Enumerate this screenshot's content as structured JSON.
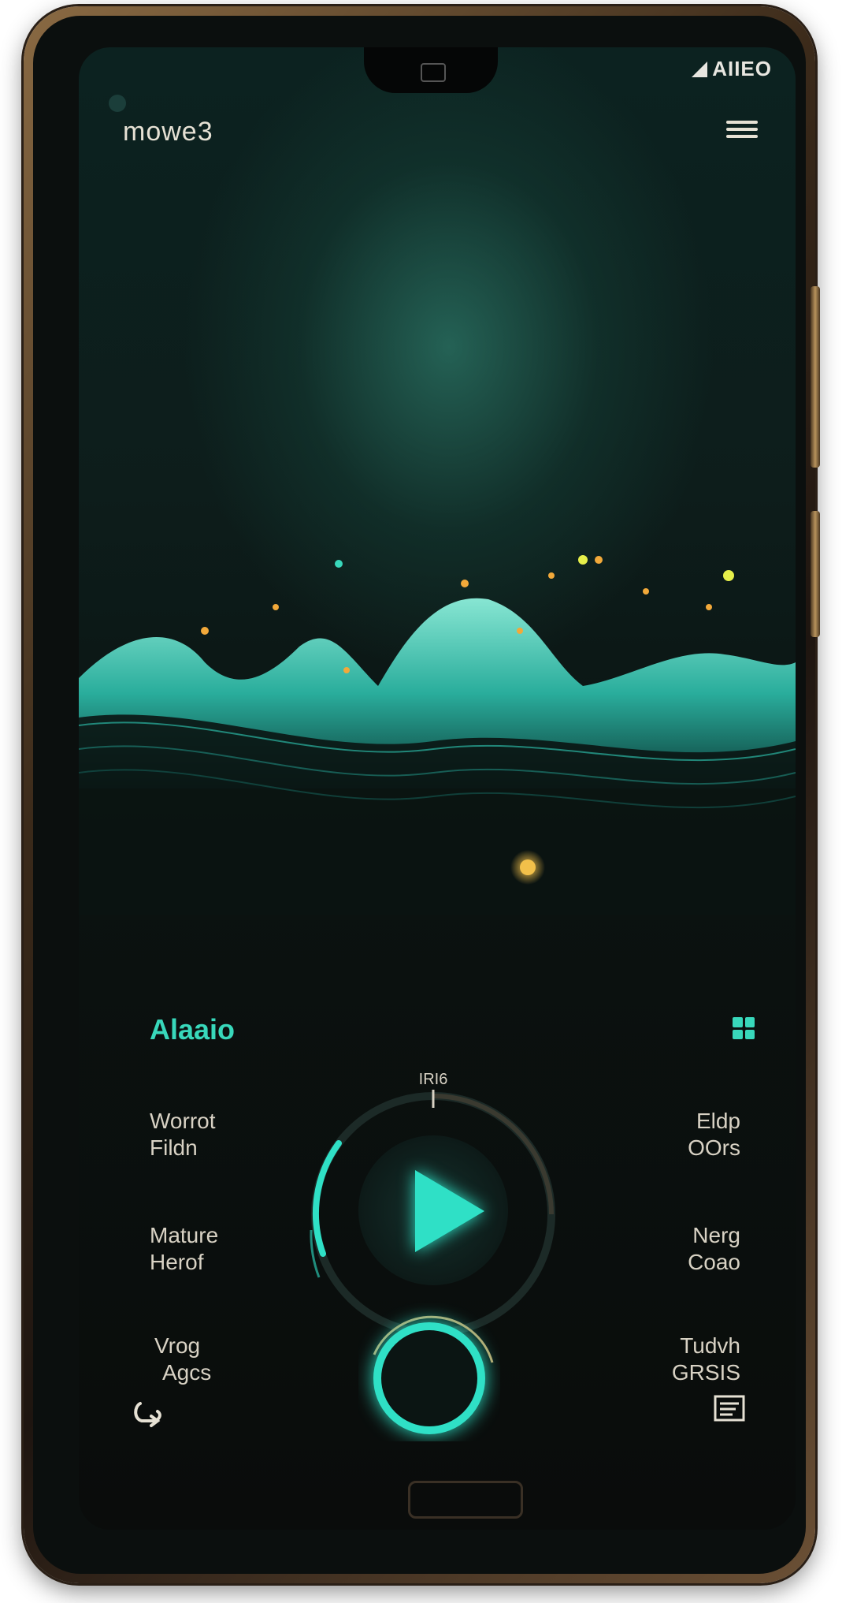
{
  "status_bar": {
    "text": "AIIEO"
  },
  "header": {
    "title": "mowe3",
    "menu_icon": "hamburger-menu-icon"
  },
  "section": {
    "label": "Alaaio",
    "view_icon": "grid-icon"
  },
  "player": {
    "dial_label": "IRI6",
    "play_icon": "play-icon",
    "record_icon": "ring-record-icon"
  },
  "left_labels": [
    {
      "line1": "Worrot",
      "line2": "Fildn"
    },
    {
      "line1": "Mature",
      "line2": "Herof"
    },
    {
      "line1": "Vrog",
      "line2": "Agcs"
    }
  ],
  "right_labels": [
    {
      "line1": "Eldp",
      "line2": "OOrs"
    },
    {
      "line1": "Nerg",
      "line2": "Coao"
    },
    {
      "line1": "Tudvh",
      "line2": "GRSIS"
    }
  ],
  "footer": {
    "left_icon": "loop-icon",
    "right_icon": "playlist-icon"
  },
  "colors": {
    "accent": "#2fe0c6",
    "text": "#d8d2c4",
    "frame": "#8a6a43"
  }
}
